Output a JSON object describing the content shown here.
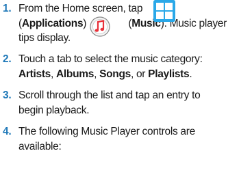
{
  "steps": [
    {
      "number": "1.",
      "line1_pre": "From the Home screen, tap",
      "line2_open": "(",
      "line2_apps": "Applications",
      "line2_arrow": ") →",
      "line2_open2": "(",
      "line2_music": "Music",
      "line2_post": "). Music player",
      "line3": "tips display."
    },
    {
      "number": "2.",
      "line1": "Touch a tab to select the music category:",
      "line2_a": "Artists",
      "line2_sep1": ", ",
      "line2_b": "Albums",
      "line2_sep2": ", ",
      "line2_c": "Songs",
      "line2_sep3": ", or ",
      "line2_d": "Playlists",
      "line2_end": "."
    },
    {
      "number": "3.",
      "line1": "Scroll through the list and tap an entry to",
      "line2": "begin playback."
    },
    {
      "number": "4.",
      "line1": "The following Music Player controls are",
      "line2": "available:"
    }
  ],
  "icons": {
    "applications": "applications-grid-icon",
    "music": "music-app-icon",
    "accent": "#1e78b8",
    "apps_color": "#2aa8e8",
    "music_color": "#e8313a"
  }
}
